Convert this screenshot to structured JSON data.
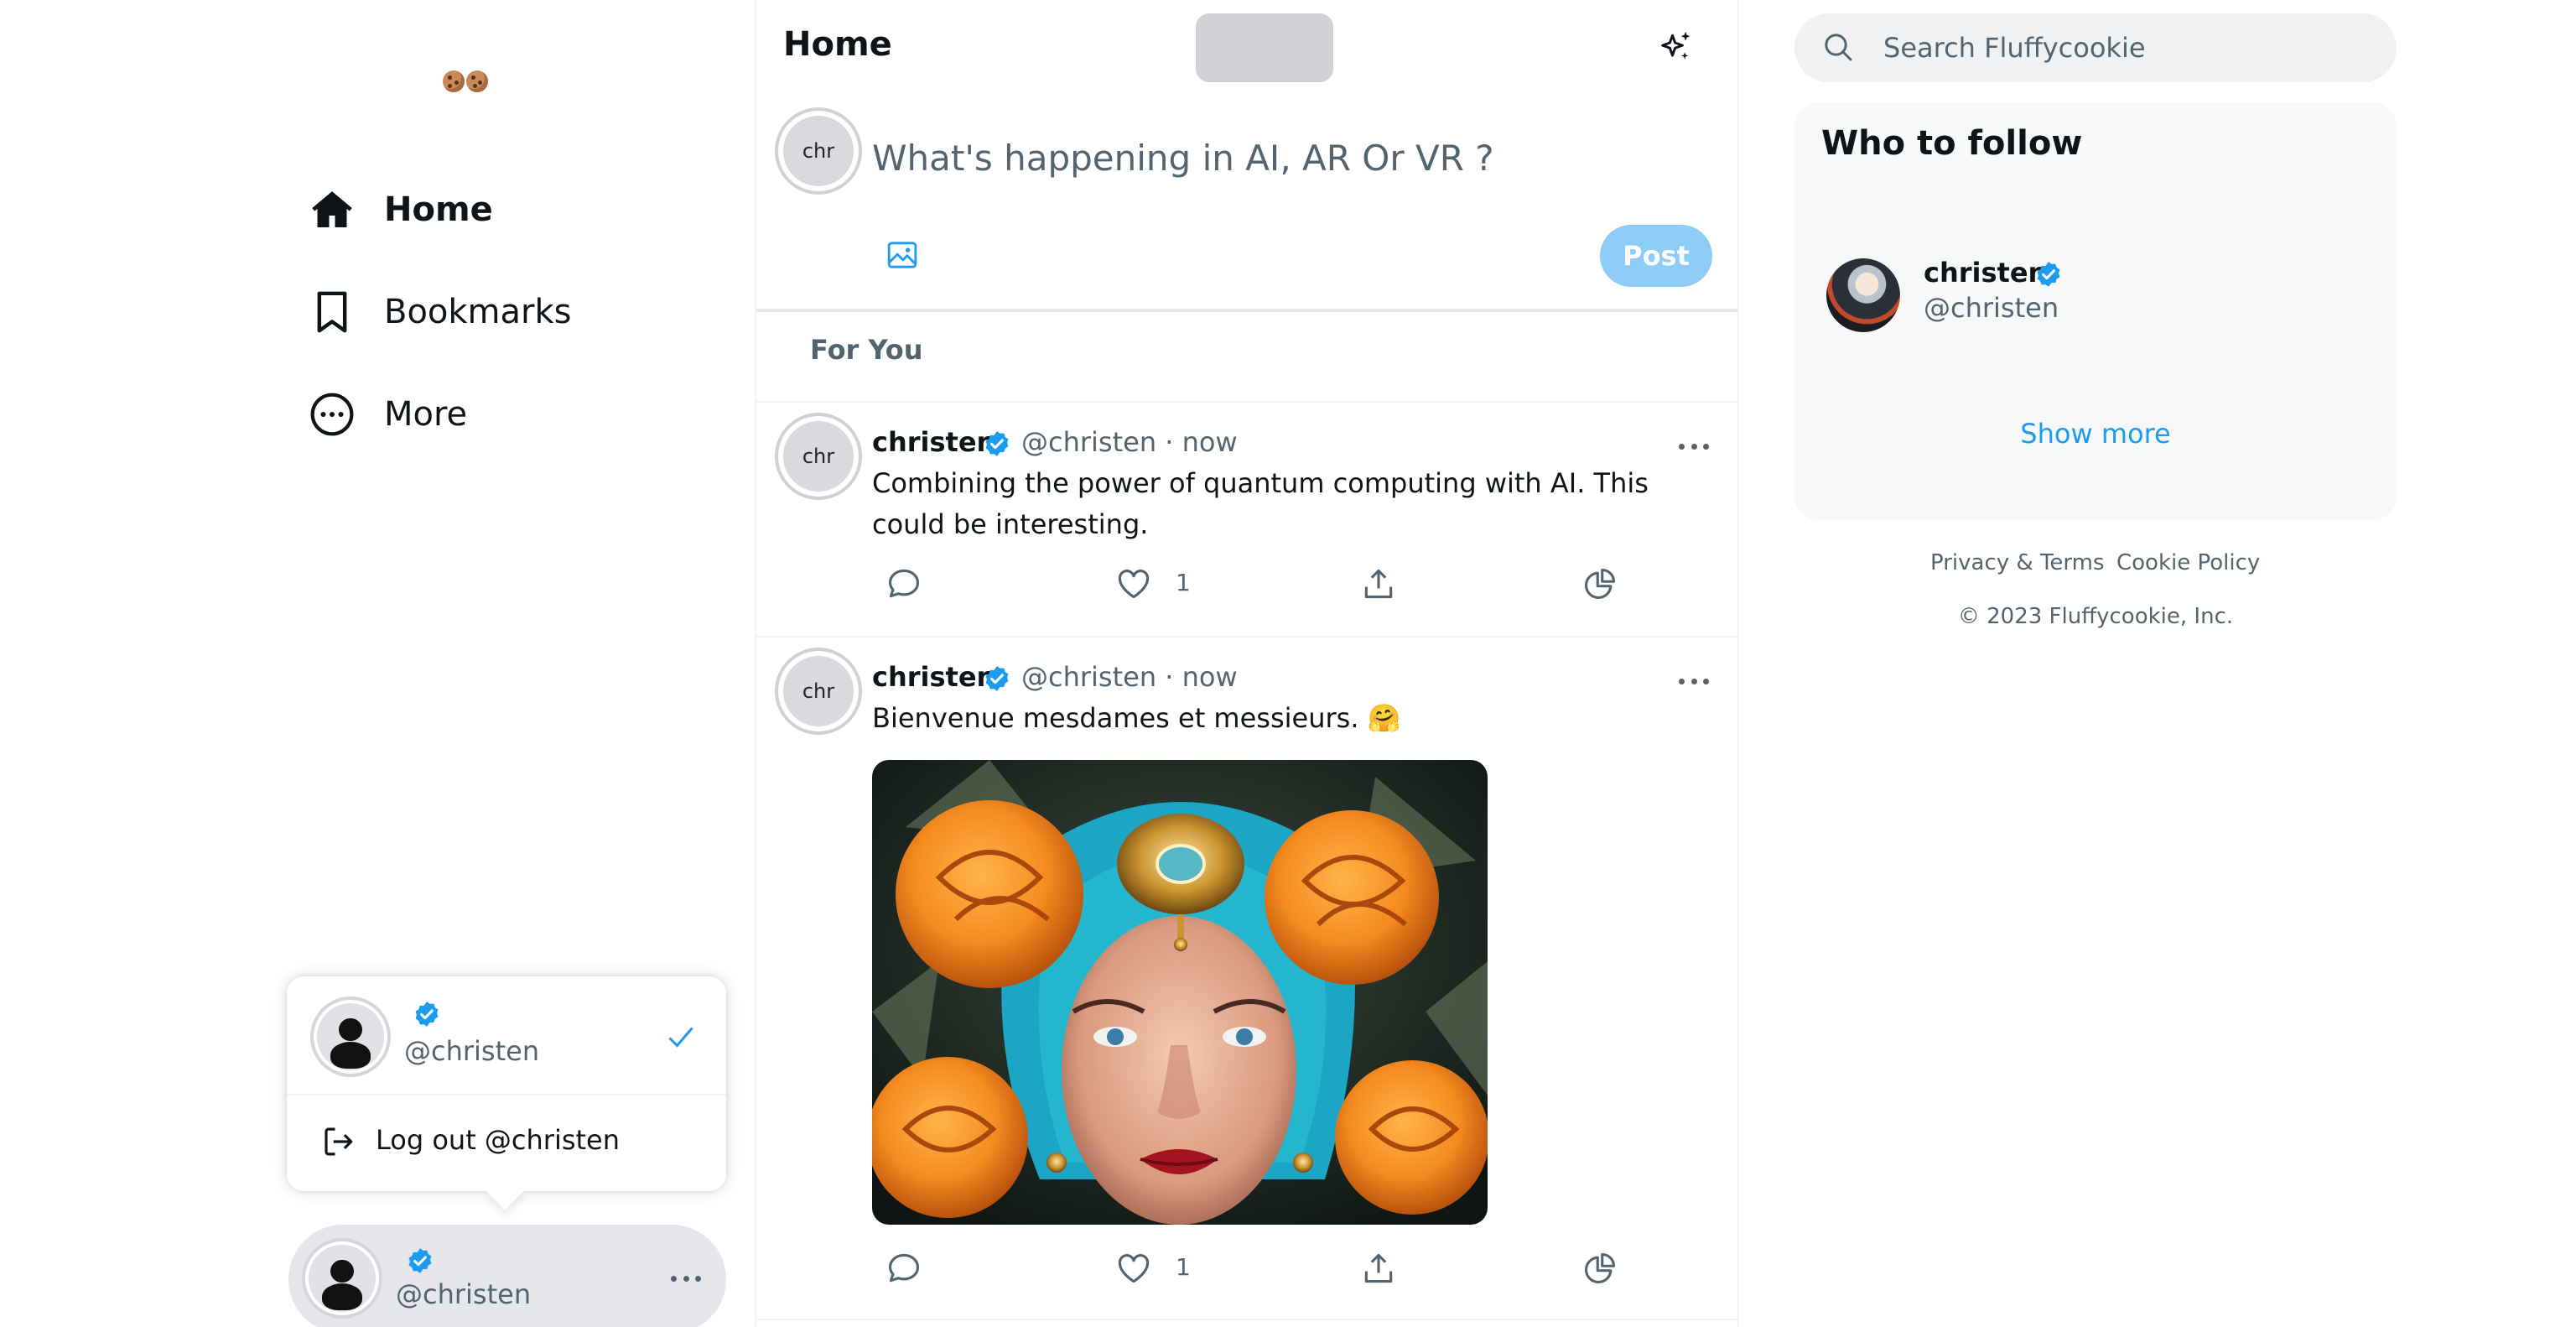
{
  "nav": {
    "items": [
      {
        "label": "Home",
        "icon": "home-icon",
        "active": true
      },
      {
        "label": "Bookmarks",
        "icon": "bookmark-icon",
        "active": false
      },
      {
        "label": "More",
        "icon": "more-circle-icon",
        "active": false
      }
    ]
  },
  "account_menu": {
    "handle": "@christen",
    "logout_label": "Log out @christen"
  },
  "account_button": {
    "handle": "@christen"
  },
  "header": {
    "title": "Home"
  },
  "composer": {
    "avatar_text": "chr",
    "placeholder": "What's happening in AI, AR Or VR ?",
    "post_label": "Post"
  },
  "feed": {
    "tab_label": "For You",
    "tweets": [
      {
        "avatar_text": "chr",
        "name": "christen",
        "meta": "@christen · now",
        "text": "Combining the power of quantum computing with AI. This could be interesting.",
        "likes": "1"
      },
      {
        "avatar_text": "chr",
        "name": "christen",
        "meta": "@christen · now",
        "text": "Bienvenue mesdames et messieurs. 🤗",
        "likes": "1"
      }
    ]
  },
  "search": {
    "placeholder": "Search Fluffycookie"
  },
  "who_to_follow": {
    "title": "Who to follow",
    "user": {
      "name": "christen",
      "handle": "@christen"
    },
    "show_more": "Show more"
  },
  "footer": {
    "links": [
      "Privacy & Terms",
      "Cookie Policy"
    ],
    "copyright": "© 2023 Fluffycookie, Inc."
  },
  "colors": {
    "accent": "#1d9bf0",
    "post_button": "#8ecdf8",
    "muted_text": "#536471"
  }
}
